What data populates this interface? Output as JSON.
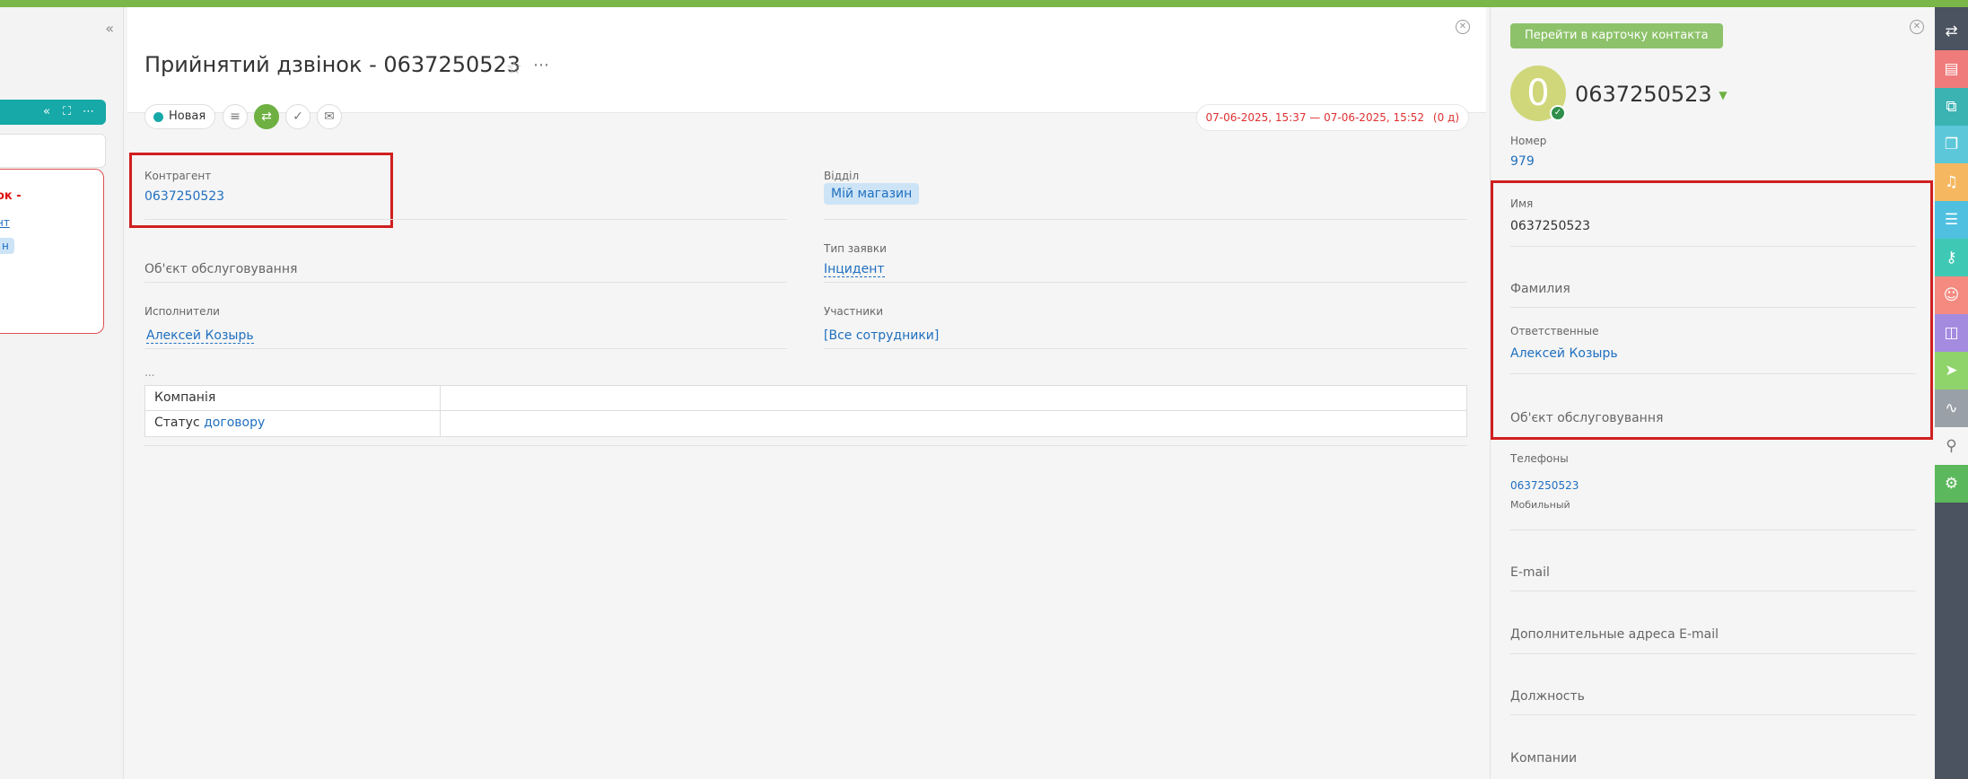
{
  "left_panel": {
    "collapse_label": "«",
    "toolbar_icons": [
      "«",
      "⛶",
      "⋯"
    ],
    "card_title": "ок -",
    "card_link": "нт",
    "card_chip": "н"
  },
  "main": {
    "title": "Прийнятий дзвінок - 0637250523",
    "status": "Новая",
    "date_range": "07-06-2025, 15:37 — 07-06-2025, 15:52",
    "duration": "(0 д)",
    "fields": {
      "kontragent_label": "Контрагент",
      "kontragent_value": "0637250523",
      "viddil_label": "Відділ",
      "viddil_value": "Мій магазин",
      "object_label": "Об'єкт обслуговування",
      "request_type_label": "Тип заявки",
      "request_type_value": "Інцидент",
      "executors_label": "Исполнители",
      "executors_value": "Алексей Козырь",
      "participants_label": "Участники",
      "participants_value": "[Все сотрудники]"
    },
    "ellipsis": "...",
    "table": {
      "row1": "Компанія",
      "row2_prefix": "Статус",
      "row2_link": "договору"
    }
  },
  "right": {
    "goto_button": "Перейти в карточку контакта",
    "avatar_letter": "0",
    "contact_name": "0637250523",
    "number_label": "Номер",
    "number_value": "979",
    "name_label": "Имя",
    "name_value": "0637250523",
    "surname_label": "Фамилия",
    "responsible_label": "Ответственные",
    "responsible_value": "Алексей Козырь",
    "object_label": "Об'єкт обслуговування",
    "phones_label": "Телефоны",
    "phone_value": "0637250523",
    "phone_type": "Мобильный",
    "email_label": "E-mail",
    "extra_email_label": "Дополнительные адреса E-mail",
    "position_label": "Должность",
    "companies_label": "Компании"
  },
  "colors": {
    "accent_green": "#7ab648",
    "teal": "#17a8a8",
    "link_blue": "#1f6fbf",
    "highlight_red": "#d01f1f",
    "sidebar_bg": "#4b5260"
  },
  "sidebar_icons": [
    "phone-transfer-icon",
    "inbox-icon",
    "workflow-icon",
    "documents-icon",
    "bell-icon",
    "clipboard-icon",
    "key-icon",
    "contact-card-icon",
    "analytics-icon",
    "send-icon",
    "activity-icon",
    "user-icon",
    "settings-icon"
  ]
}
